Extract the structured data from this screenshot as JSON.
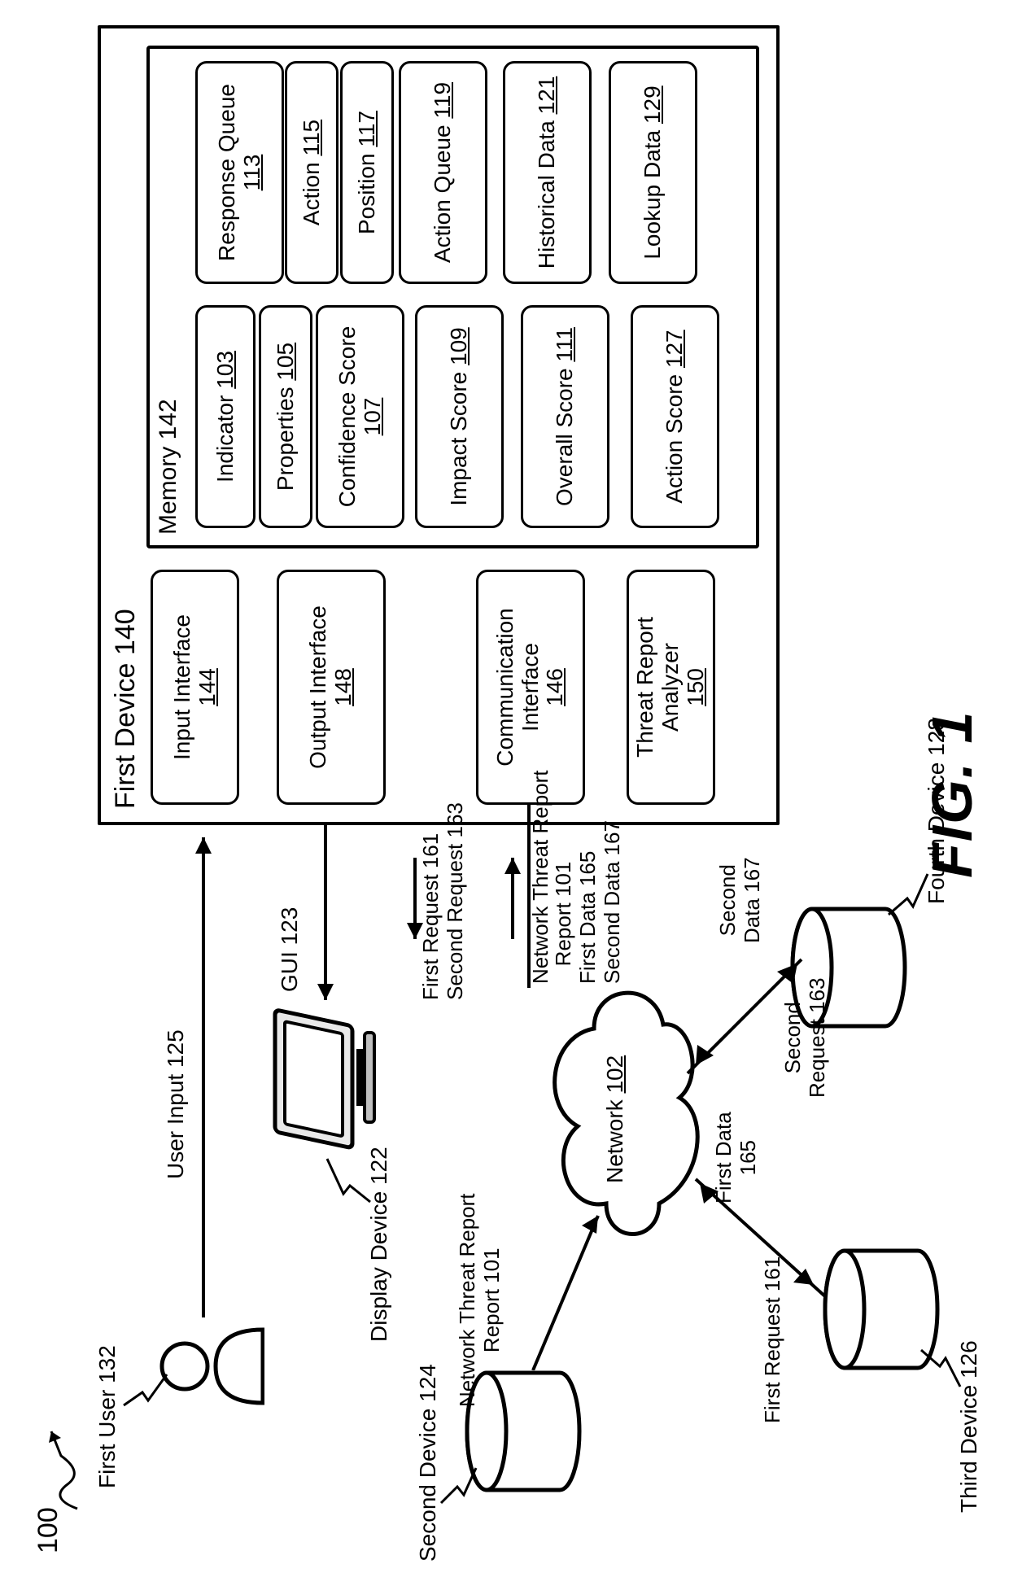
{
  "figure_ref": "100",
  "figure_caption": "FIG. 1",
  "first_user": {
    "label": "First User",
    "ref": "132"
  },
  "user_input": {
    "label": "User Input",
    "ref": "125"
  },
  "display_device": {
    "label": "Display Device",
    "ref": "122"
  },
  "gui": {
    "label": "GUI",
    "ref": "123"
  },
  "first_device": {
    "label": "First Device",
    "ref": "140"
  },
  "input_interface": {
    "label": "Input Interface",
    "ref": "144"
  },
  "output_interface": {
    "label": "Output Interface",
    "ref": "148"
  },
  "communication_interface": {
    "label": "Communication Interface",
    "ref": "146"
  },
  "threat_report_analyzer": {
    "label": "Threat Report Analyzer",
    "ref": "150"
  },
  "memory": {
    "label": "Memory",
    "ref": "142"
  },
  "memory_items_left": [
    {
      "label": "Indicator",
      "ref": "103"
    },
    {
      "label": "Properties",
      "ref": "105"
    },
    {
      "label": "Confidence Score",
      "ref": "107"
    },
    {
      "label": "Impact Score",
      "ref": "109"
    },
    {
      "label": "Overall Score",
      "ref": "111"
    },
    {
      "label": "Action Score",
      "ref": "127"
    }
  ],
  "memory_items_right": [
    {
      "label": "Response Queue",
      "ref": "113"
    },
    {
      "label": "Action",
      "ref": "115"
    },
    {
      "label": "Position",
      "ref": "117"
    },
    {
      "label": "Action Queue",
      "ref": "119"
    },
    {
      "label": "Historical Data",
      "ref": "121"
    },
    {
      "label": "Lookup Data",
      "ref": "129"
    }
  ],
  "network": {
    "label": "Network",
    "ref": "102"
  },
  "second_device": {
    "label": "Second Device",
    "ref": "124"
  },
  "third_device": {
    "label": "Third Device",
    "ref": "126"
  },
  "fourth_device": {
    "label": "Fourth Device",
    "ref": "128"
  },
  "network_threat_report": {
    "label": "Network Threat Report",
    "ref": "101"
  },
  "first_request": {
    "label": "First Request",
    "ref": "161"
  },
  "second_request": {
    "label": "Second Request",
    "ref": "163"
  },
  "first_data": {
    "label": "First Data",
    "ref": "165"
  },
  "second_data": {
    "label": "Second Data",
    "ref": "167"
  },
  "flows": {
    "to_first_device": [
      {
        "label": "First Request",
        "ref": "161"
      },
      {
        "label": "Second Request",
        "ref": "163"
      }
    ],
    "from_network_to_first_device": [
      {
        "label": "Network Threat Report",
        "ref": "101"
      },
      {
        "label": "First Data",
        "ref": "165"
      },
      {
        "label": "Second Data",
        "ref": "167"
      }
    ]
  }
}
